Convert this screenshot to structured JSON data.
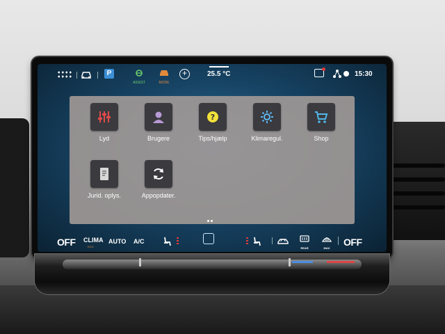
{
  "statusbar": {
    "assist_label": "ASSIST",
    "mode_label": "MODE",
    "park_label": "P",
    "temperature": "25.5 °C",
    "time": "15:30"
  },
  "apps": [
    {
      "label": "Lyd",
      "icon": "sliders-icon",
      "color": "#e24a4a"
    },
    {
      "label": "Brugere",
      "icon": "user-icon",
      "color": "#b89ad6"
    },
    {
      "label": "Tips/hjælp",
      "icon": "help-icon",
      "color": "#f2e13a"
    },
    {
      "label": "Klimaregul.",
      "icon": "climate-sun-icon",
      "color": "#5fb8f2"
    },
    {
      "label": "Shop",
      "icon": "cart-icon",
      "color": "#4fb7e8"
    },
    {
      "label": "Jurid. oplys.",
      "icon": "document-icon",
      "color": "#d8d8d8"
    },
    {
      "label": "Appopdater.",
      "icon": "refresh-icon",
      "color": "#ffffff"
    }
  ],
  "climate": {
    "off_left": "OFF",
    "clima": "CLIMA",
    "clima_sub": "ECO",
    "auto": "AUTO",
    "ac": "A/C",
    "rear": "REAR",
    "max": "MAX",
    "off_right": "OFF"
  },
  "colors": {
    "accent_red": "#e03a3a",
    "accent_orange": "#e08a3c",
    "accent_green": "#6fd36f",
    "accent_blue": "#3d8fd6"
  }
}
